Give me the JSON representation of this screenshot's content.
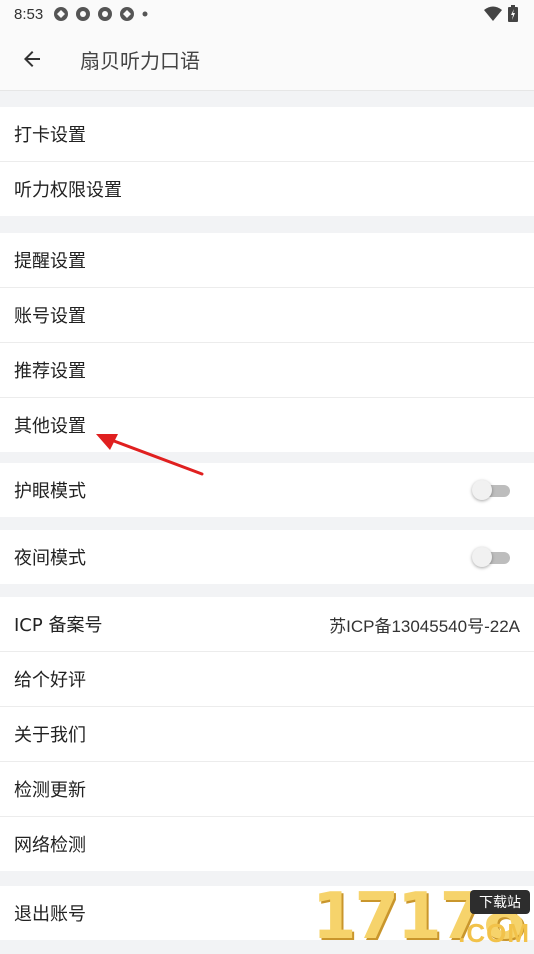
{
  "status_bar": {
    "time": "8:53",
    "icons": [
      "app-notification-icon",
      "app-notification-icon",
      "app-notification-icon",
      "app-notification-icon",
      "dot-icon"
    ],
    "right_icons": [
      "wifi-icon",
      "battery-icon"
    ]
  },
  "app_bar": {
    "title": "扇贝听力口语",
    "back_icon": "arrow-back-icon"
  },
  "groups": {
    "g1": [
      {
        "label": "打卡设置"
      },
      {
        "label": "听力权限设置"
      }
    ],
    "g2": [
      {
        "label": "提醒设置"
      },
      {
        "label": "账号设置"
      },
      {
        "label": "推荐设置"
      },
      {
        "label": "其他设置"
      }
    ],
    "g3": [
      {
        "label": "护眼模式",
        "toggle": false
      }
    ],
    "g4": [
      {
        "label": "夜间模式",
        "toggle": false
      }
    ],
    "g5": [
      {
        "label": "ICP 备案号",
        "value": "苏ICP备13045540号-22A"
      },
      {
        "label": "给个好评"
      },
      {
        "label": "关于我们"
      },
      {
        "label": "检测更新"
      },
      {
        "label": "网络检测"
      }
    ],
    "g6": [
      {
        "label": "退出账号"
      }
    ]
  },
  "watermark": {
    "digits": "17178",
    "badge": "下载站",
    "domain": ".COM"
  },
  "colors": {
    "annotation_arrow": "#e02020",
    "toggle_off_track": "#bdbdbd",
    "background": "#f2f3f5"
  }
}
